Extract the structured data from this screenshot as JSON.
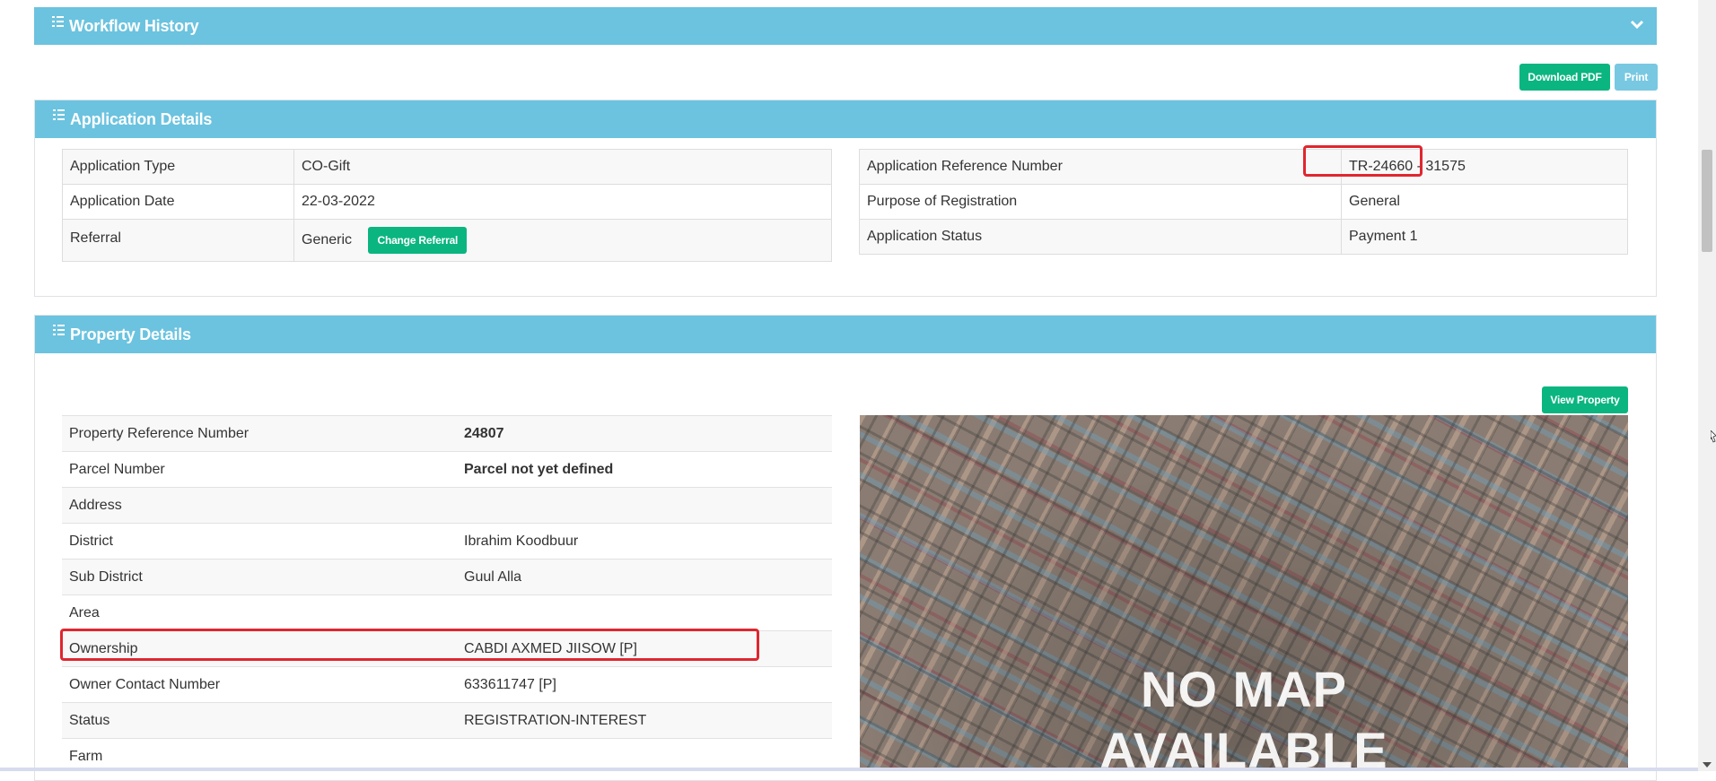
{
  "workflow": {
    "title": "Workflow History"
  },
  "toolbar": {
    "download_pdf": "Download PDF",
    "print": "Print"
  },
  "application": {
    "title": "Application Details",
    "left_rows": [
      {
        "label": "Application Type",
        "value": "CO-Gift"
      },
      {
        "label": "Application Date",
        "value": "22-03-2022"
      },
      {
        "label": "Referral",
        "value": "Generic",
        "button": "Change Referral"
      }
    ],
    "right_rows": [
      {
        "label": "Application Reference Number",
        "value": "TR-24660 - 31575"
      },
      {
        "label": "Purpose of Registration",
        "value": "General"
      },
      {
        "label": "Application Status",
        "value": "Payment 1"
      }
    ]
  },
  "property": {
    "title": "Property Details",
    "view_button": "View Property",
    "rows": [
      {
        "label": "Property Reference Number",
        "value": "24807"
      },
      {
        "label": "Parcel Number",
        "value": "Parcel not yet defined"
      },
      {
        "label": "Address",
        "value": ""
      },
      {
        "label": "District",
        "value": "Ibrahim Koodbuur"
      },
      {
        "label": "Sub District",
        "value": "Guul Alla"
      },
      {
        "label": "Area",
        "value": ""
      },
      {
        "label": "Ownership",
        "value": "CABDI AXMED JIISOW [P]"
      },
      {
        "label": "Owner Contact Number",
        "value": "633611747 [P]"
      },
      {
        "label": "Status",
        "value": "REGISTRATION-INTEREST"
      },
      {
        "label": "Farm",
        "value": ""
      }
    ],
    "map_line1": "NO MAP",
    "map_line2": "AVAILABLE"
  },
  "colors": {
    "header": "#6bc3df",
    "button_green": "#0bb580",
    "highlight": "#e0262f"
  }
}
